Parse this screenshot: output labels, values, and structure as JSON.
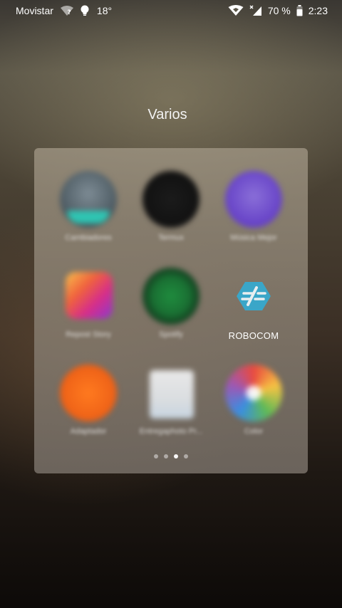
{
  "status_bar": {
    "carrier": "Movistar",
    "temperature": "18°",
    "battery_percent": "70 %",
    "time": "2:23",
    "icons": [
      "wifi-question-icon",
      "lightbulb-icon",
      "hotspot-icon",
      "signal-icon",
      "battery-icon"
    ]
  },
  "folder": {
    "title": "Varios",
    "apps": [
      {
        "label": "Cambiadores",
        "icon": "cs-icon",
        "blurred": true
      },
      {
        "label": "Termux",
        "icon": "terminal-icon",
        "blurred": true
      },
      {
        "label": "Música Mejor",
        "icon": "music-app-icon",
        "blurred": true
      },
      {
        "label": "Repost Story",
        "icon": "instagram-icon",
        "blurred": true
      },
      {
        "label": "Spotify",
        "icon": "spotify-icon",
        "blurred": true
      },
      {
        "label": "ROBOCOM",
        "icon": "robocom-icon",
        "blurred": false
      },
      {
        "label": "Adaptador",
        "icon": "orange-app-icon",
        "blurred": true
      },
      {
        "label": "Entregaphoto Pr...",
        "icon": "document-app-icon",
        "blurred": true
      },
      {
        "label": "Color",
        "icon": "color-wheel-icon",
        "blurred": true
      }
    ],
    "pager": {
      "pages": 4,
      "current": 3
    }
  },
  "colors": {
    "robocom_accent": "#3aa6c8"
  }
}
